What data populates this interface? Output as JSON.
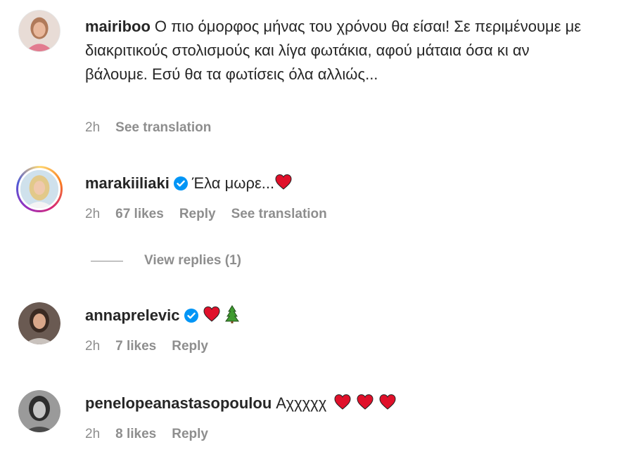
{
  "comments": [
    {
      "username": "mairiboo",
      "text": "Ο πιο όμορφος μήνας του χρόνου θα είσαι! Σε περιμένουμε με διακριτικούς στολισμούς και λίγα φωτάκια, αφού μάταια όσα κι αν βάλουμε. Εσύ θα τα φωτίσεις όλα αλλιώς...",
      "time": "2h",
      "see_translation": "See translation"
    },
    {
      "username": "marakiiliaki",
      "text": "Έλα μωρε...",
      "time": "2h",
      "likes": "67 likes",
      "reply": "Reply",
      "see_translation": "See translation",
      "view_replies": "View replies (1)"
    },
    {
      "username": "annaprelevic",
      "text": "",
      "time": "2h",
      "likes": "7 likes",
      "reply": "Reply"
    },
    {
      "username": "penelopeanastasopoulou",
      "text": "Αχχχχχ",
      "time": "2h",
      "likes": "8 likes",
      "reply": "Reply"
    }
  ],
  "icons": {
    "verified": "verified-badge-icon",
    "heart": "red-heart-emoji",
    "tree": "christmas-tree-emoji"
  },
  "colors": {
    "text": "#262626",
    "meta": "#8e8e8e",
    "verified": "#0095f6",
    "heart": "#e0102a"
  }
}
